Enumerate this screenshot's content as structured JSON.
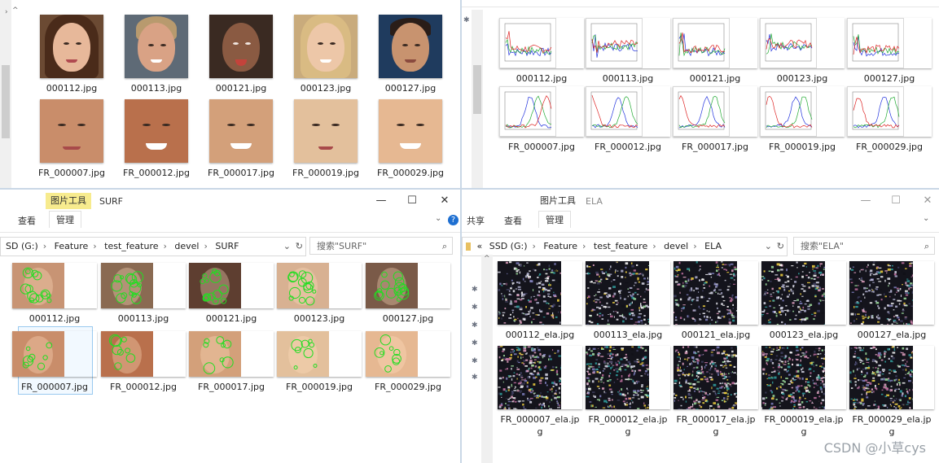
{
  "top_left": {
    "row1": [
      "000112.jpg",
      "000113.jpg",
      "000121.jpg",
      "000123.jpg",
      "000127.jpg"
    ],
    "row2": [
      "FR_000007.jpg",
      "FR_000012.jpg",
      "FR_000017.jpg",
      "FR_000019.jpg",
      "FR_000029.jpg"
    ]
  },
  "top_right": {
    "row1": [
      "000112.jpg",
      "000113.jpg",
      "000121.jpg",
      "000123.jpg",
      "000127.jpg"
    ],
    "row2": [
      "FR_000007.jpg",
      "FR_000012.jpg",
      "FR_000017.jpg",
      "FR_000019.jpg",
      "FR_000029.jpg"
    ]
  },
  "surf_window": {
    "context_tab": "图片工具",
    "title": "SURF",
    "tabs": [
      "查看",
      "管理"
    ],
    "controls": {
      "minimize": "—",
      "maximize": "☐",
      "close": "✕"
    },
    "breadcrumb": [
      "SD (G:)",
      "Feature",
      "test_feature",
      "devel",
      "SURF"
    ],
    "search_placeholder": "搜索\"SURF\"",
    "row1": [
      "000112.jpg",
      "000113.jpg",
      "000121.jpg",
      "000123.jpg",
      "000127.jpg"
    ],
    "row2": [
      "FR_000007.jpg",
      "FR_000012.jpg",
      "FR_000017.jpg",
      "FR_000019.jpg",
      "FR_000029.jpg"
    ]
  },
  "ela_window": {
    "context_tab": "图片工具",
    "title": "ELA",
    "tabs": [
      "共享",
      "查看",
      "管理"
    ],
    "controls": {
      "minimize": "—",
      "maximize": "☐",
      "close": "✕"
    },
    "nav_back": "«",
    "breadcrumb": [
      "SSD (G:)",
      "Feature",
      "test_feature",
      "devel",
      "ELA"
    ],
    "search_placeholder": "搜索\"ELA\"",
    "row1": [
      "000112_ela.jpg",
      "000113_ela.jpg",
      "000121_ela.jpg",
      "000123_ela.jpg",
      "000127_ela.jpg"
    ],
    "row2": [
      "FR_000007_ela.jpg",
      "FR_000012_ela.jpg",
      "FR_000017_ela.jpg",
      "FR_000019_ela.jpg",
      "FR_000029_ela.jpg"
    ]
  },
  "watermark": "CSDN @小草cys",
  "colors": {
    "divider": "#c9d7e6",
    "context_tab": "#f7eb8e",
    "selection": "#99c9ef",
    "surf_keypoint": "#22dd22"
  }
}
